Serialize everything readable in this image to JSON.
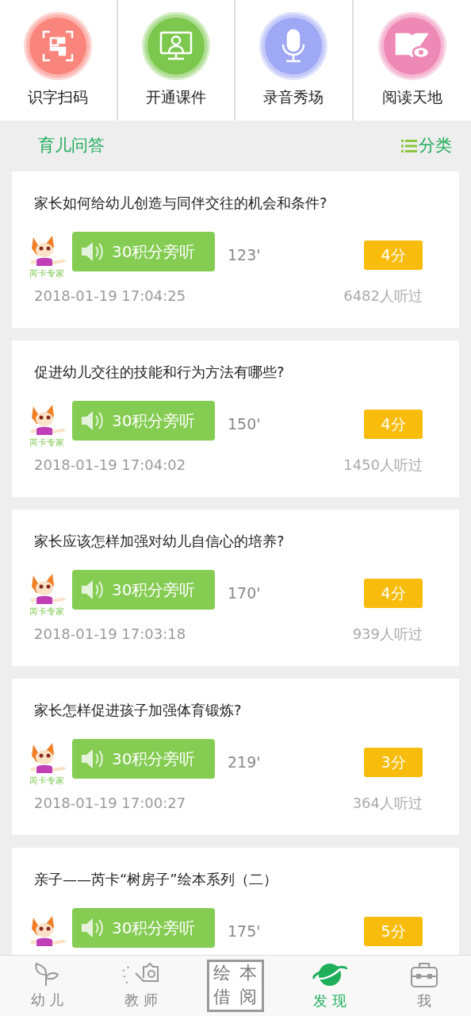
{
  "shortcuts": [
    {
      "kind": "scan",
      "label": "识字扫码",
      "color": "#fa857c"
    },
    {
      "kind": "courseware",
      "label": "开通课件",
      "color": "#7cc84e"
    },
    {
      "kind": "mic",
      "label": "录音秀场",
      "color": "#9fa8f5"
    },
    {
      "kind": "book",
      "label": "阅读天地",
      "color": "#ee88b4"
    }
  ],
  "section": {
    "title": "育儿问答",
    "category": "分类"
  },
  "questions": [
    {
      "title": "家长如何给幼儿创造与同伴交往的机会和条件?",
      "expert": "芮卡专家",
      "listen": "30积分旁听",
      "duration": "123'",
      "score": "4分",
      "date": "2018-01-19 17:04:25",
      "listeners": "6482人听过"
    },
    {
      "title": "促进幼儿交往的技能和行为方法有哪些?",
      "expert": "芮卡专家",
      "listen": "30积分旁听",
      "duration": "150'",
      "score": "4分",
      "date": "2018-01-19 17:04:02",
      "listeners": "1450人听过"
    },
    {
      "title": "家长应该怎样加强对幼儿自信心的培养?",
      "expert": "芮卡专家",
      "listen": "30积分旁听",
      "duration": "170'",
      "score": "4分",
      "date": "2018-01-19 17:03:18",
      "listeners": "939人听过"
    },
    {
      "title": "家长怎样促进孩子加强体育锻炼?",
      "expert": "芮卡专家",
      "listen": "30积分旁听",
      "duration": "219'",
      "score": "3分",
      "date": "2018-01-19 17:00:27",
      "listeners": "364人听过"
    },
    {
      "title": "亲子——芮卡“树房子”绘本系列（二）",
      "listen": "30积分旁听",
      "duration": "175'",
      "score": "5分"
    }
  ],
  "tabs": [
    {
      "kind": "sprout",
      "label": "幼 儿",
      "selected": false
    },
    {
      "kind": "watering",
      "label": "教 师",
      "selected": false
    },
    {
      "kind": "picturebook",
      "chars": [
        "绘",
        "本",
        "借",
        "阅"
      ],
      "selected": false
    },
    {
      "kind": "planet",
      "label": "发 现",
      "selected": true
    },
    {
      "kind": "bag",
      "label": "我",
      "selected": false
    }
  ]
}
